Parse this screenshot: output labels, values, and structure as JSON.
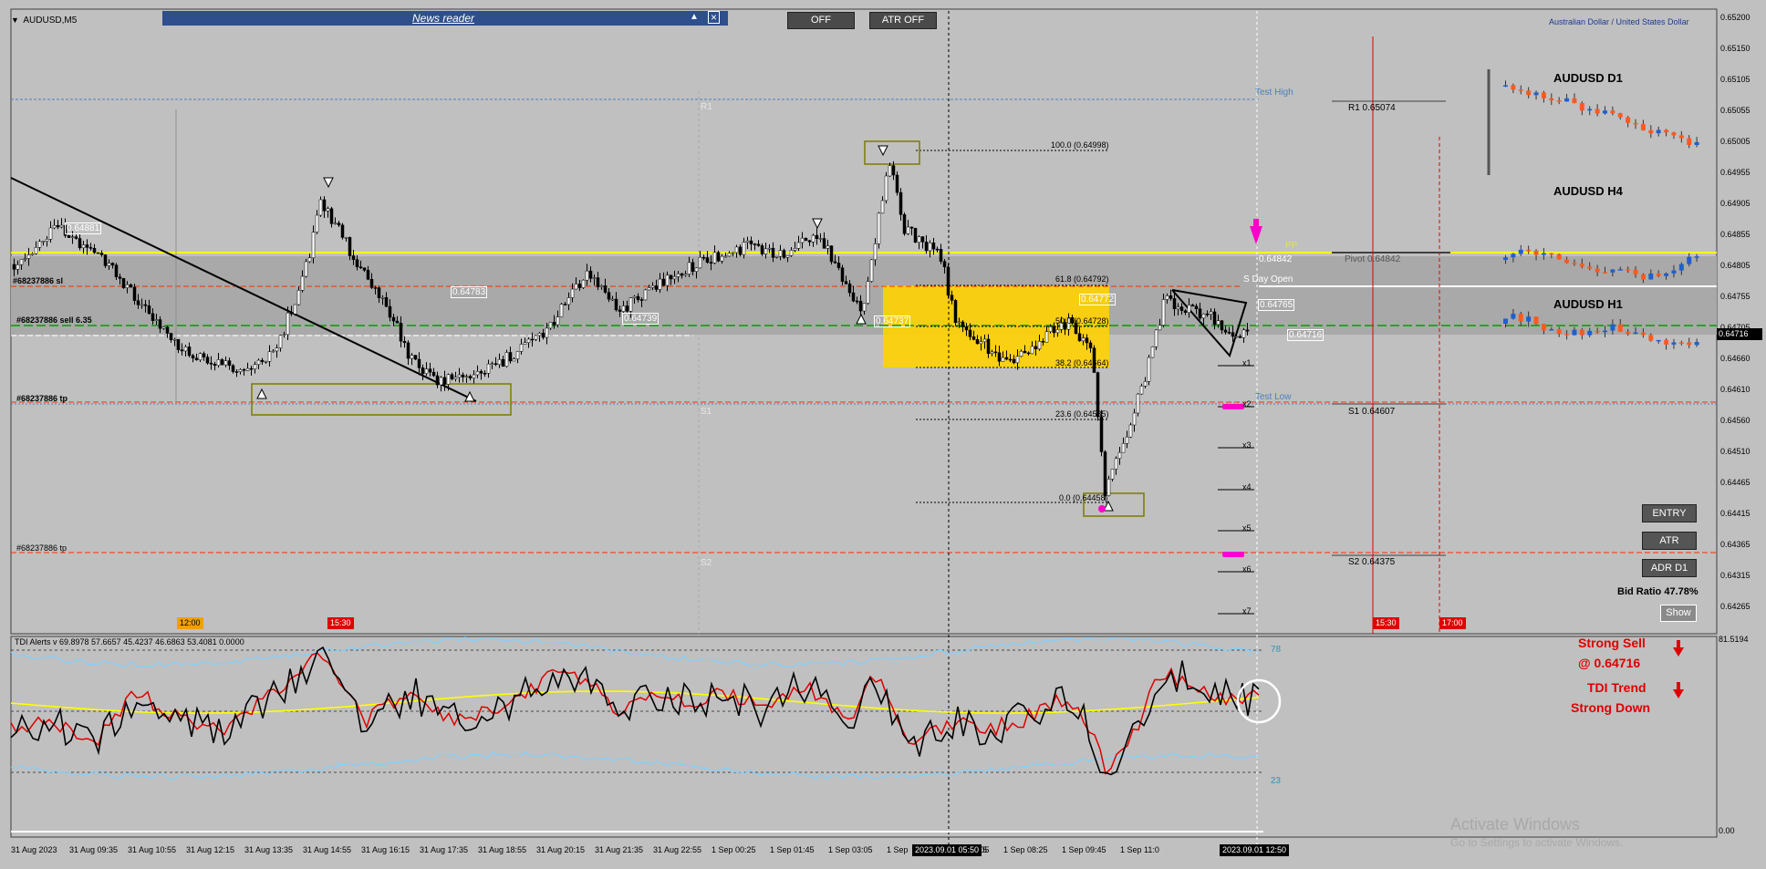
{
  "window": {
    "symbol_title": "AUDUSD,M5",
    "instrument_name": "Australian Dollar / United States Dollar"
  },
  "news_reader": {
    "label": "News reader",
    "min_icon": "triangle-up-icon",
    "close_icon": "close-box-icon"
  },
  "toolbar": {
    "off_label": "OFF",
    "atr_off_label": "ATR OFF"
  },
  "price_axis": [
    "0.65200",
    "0.65150",
    "0.65105",
    "0.65055",
    "0.65005",
    "0.64955",
    "0.64905",
    "0.64855",
    "0.64805",
    "0.64755",
    "0.64705",
    "0.64660",
    "0.64610",
    "0.64560",
    "0.64510",
    "0.64465",
    "0.64415",
    "0.64365",
    "0.64315",
    "0.64265"
  ],
  "current_price_tag": "0.64716",
  "time_axis": [
    "31 Aug 2023",
    "31 Aug 09:35",
    "31 Aug 10:55",
    "31 Aug 12:15",
    "31 Aug 13:35",
    "31 Aug 14:55",
    "31 Aug 16:15",
    "31 Aug 17:35",
    "31 Aug 18:55",
    "31 Aug 20:15",
    "31 Aug 21:35",
    "31 Aug 22:55",
    "1 Sep 00:25",
    "1 Sep 01:45",
    "1 Sep 03:05",
    "1 Sep",
    "1 Sep 07:05",
    "1 Sep 08:25",
    "1 Sep 09:45",
    "1 Sep 11:0"
  ],
  "crosshair_time_1": "2023.09.01 05:50",
  "crosshair_time_2": "2023.09.01 12:50",
  "crosshair_frag": "5",
  "time_markers": {
    "m1": "12:00",
    "m2": "15:30",
    "m3": "15:30",
    "m4": "17:00"
  },
  "levels": {
    "test_high": "Test High",
    "test_low": "Test Low",
    "r1_left": "R1",
    "r1": "R1 0.65074",
    "pivot": "Pivot 0.64842",
    "pp": "PP",
    "s1_left": "S1",
    "s1": "S1 0.64607",
    "s2_left": "S2",
    "s2": "S2 0.64375",
    "day_open": "S  Day Open",
    "price_0_64842": "0.64842",
    "price_0_64765": "0.64765",
    "price_0_64716": "0.64716"
  },
  "trade_labels": {
    "sl": "#68237886 sl",
    "sell": "#68237886 sell 6.35",
    "tp1": "#68237886 tp",
    "tp2": "#68237886 tp"
  },
  "fib": {
    "f100": "100.0 (0.64998)",
    "f618": "61.8 (0.64792)",
    "f50": "50.0 (0.64728)",
    "f382": "38.2 (0.64664)",
    "f236": "23.6 (0.64585)",
    "f0": "0.0 (0.64458)"
  },
  "price_labels": {
    "p1": "0.64881",
    "p2": "0.64783",
    "p3": "0.64739",
    "p4": "0.64737",
    "p5": "0.64772"
  },
  "x_levels": [
    "x1",
    "x2",
    "x3",
    "x4",
    "x5",
    "x6",
    "x7"
  ],
  "mini_panes": {
    "d1": "AUDUSD D1",
    "h4": "AUDUSD H4",
    "h1": "AUDUSD H1"
  },
  "right_panel": {
    "entry": "ENTRY",
    "atr": "ATR",
    "adr": "ADR D1",
    "bid_ratio": "Bid Ratio 47.78%",
    "show": "Show"
  },
  "indicator": {
    "title": "TDI Alerts v 69.8978 57.6657 45.4237 46.6863 53.4081 0.0000",
    "axis_top": "81.5194",
    "axis_bottom": "0.00",
    "level_78": "78",
    "level_23": "23",
    "signal1": "Strong Sell",
    "signal2": "@ 0.64716",
    "signal3": "TDI Trend",
    "signal4": "Strong Down",
    "arrow_icon": "red-down-arrow-icon"
  },
  "watermark": {
    "line1": "Activate Windows",
    "line2": "Go to Settings to activate Windows."
  },
  "colors": {
    "chart_bg": "#c0c0c0",
    "yellow": "#ffff00",
    "fib_box": "#ffd200",
    "red_line": "#ff2a00",
    "green_dash": "#00a000",
    "magenta": "#ff00cc",
    "bull": "#1e5fd0",
    "bear": "#ff5a1e"
  }
}
